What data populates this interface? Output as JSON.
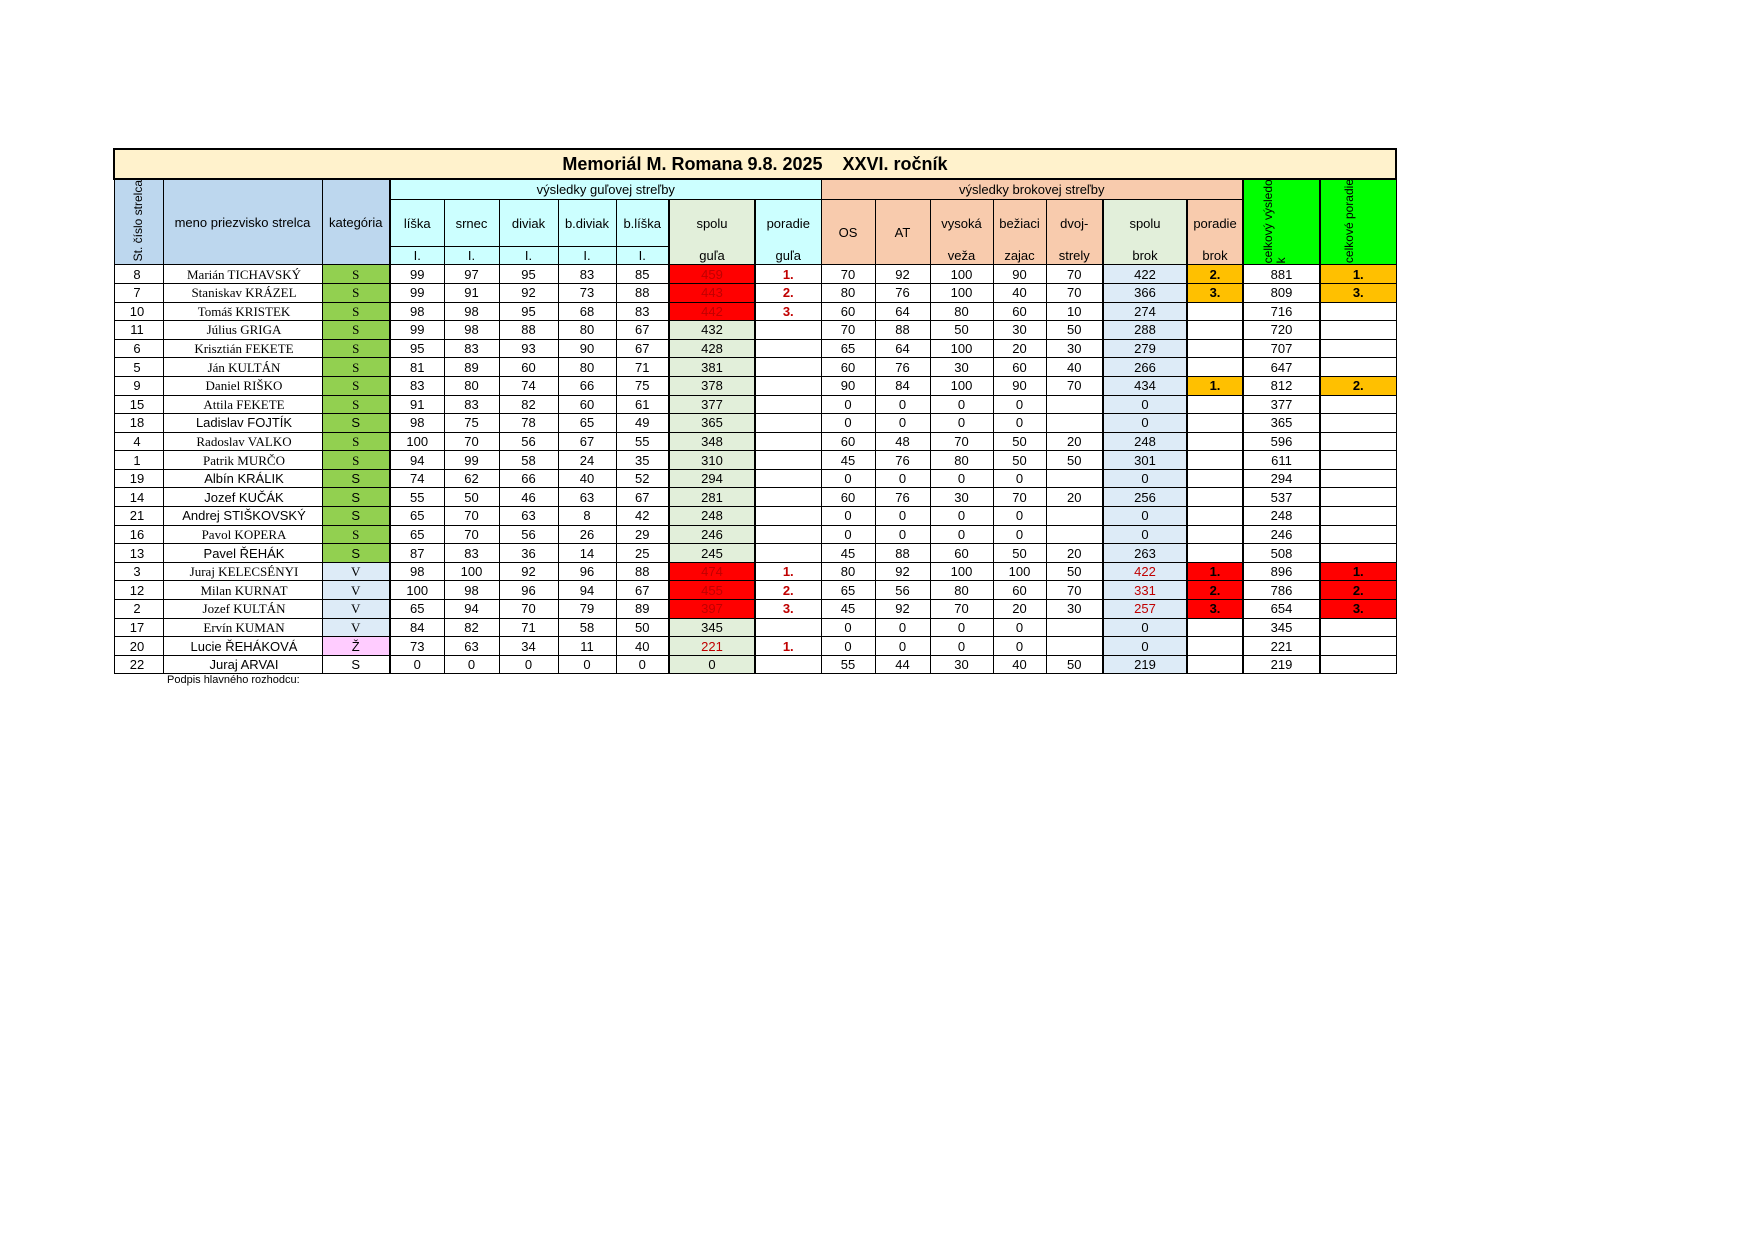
{
  "title": "Memoriál M. Romana 9.8. 2025    XXVI. ročník",
  "headers": {
    "st_cislo": "St. číslo strelca",
    "meno": "meno priezvisko strelca",
    "kategoria": "kategória",
    "gula_group": "výsledky guľovej streľby",
    "brok_group": "výsledky brokovej streľby",
    "liska": "líška",
    "srnec": "srnec",
    "diviak": "diviak",
    "bdiviak": "b.diviak",
    "bliska": "b.líška",
    "round": "I.",
    "spolu_gula_1": "spolu",
    "spolu_gula_2": "guľa",
    "poradie_gula_1": "poradie",
    "poradie_gula_2": "guľa",
    "os": "OS",
    "at": "AT",
    "vysoka_1": "vysoká",
    "vysoka_2": "veža",
    "beziaci_1": "bežiaci",
    "beziaci_2": "zajac",
    "dvoj_1": "dvoj-",
    "dvoj_2": "strely",
    "spolu_brok_1": "spolu",
    "spolu_brok_2": "brok",
    "poradie_brok_1": "poradie",
    "poradie_brok_2": "brok",
    "celkovy": "celkový výsledo k",
    "celkove": "celkové poradie"
  },
  "rows": [
    {
      "no": "8",
      "name": "Marián TICHAVSKÝ",
      "serif": true,
      "cat": "S",
      "g": [
        "99",
        "97",
        "95",
        "83",
        "85"
      ],
      "sg": "459",
      "sgc": "red",
      "pg": "1.",
      "b": [
        "70",
        "92",
        "100",
        "90",
        "70"
      ],
      "sb": "422",
      "sbc": "lblue",
      "pb": "2.",
      "pbc": "orange",
      "total": "881",
      "tr": "1.",
      "trc": "orange"
    },
    {
      "no": "7",
      "name": "Staniskav KRÁZEL",
      "serif": true,
      "cat": "S",
      "g": [
        "99",
        "91",
        "92",
        "73",
        "88"
      ],
      "sg": "443",
      "sgc": "red",
      "pg": "2.",
      "b": [
        "80",
        "76",
        "100",
        "40",
        "70"
      ],
      "sb": "366",
      "sbc": "lblue",
      "pb": "3.",
      "pbc": "orange",
      "total": "809",
      "tr": "3.",
      "trc": "orange"
    },
    {
      "no": "10",
      "name": "Tomáš KRISTEK",
      "serif": true,
      "cat": "S",
      "g": [
        "98",
        "98",
        "95",
        "68",
        "83"
      ],
      "sg": "442",
      "sgc": "red",
      "pg": "3.",
      "b": [
        "60",
        "64",
        "80",
        "60",
        "10"
      ],
      "sb": "274",
      "sbc": "lblue",
      "pb": "",
      "pbc": "",
      "total": "716",
      "tr": "",
      "trc": ""
    },
    {
      "no": "11",
      "name": "Július GRIGA",
      "serif": true,
      "cat": "S",
      "g": [
        "99",
        "98",
        "88",
        "80",
        "67"
      ],
      "sg": "432",
      "sgc": "lgreen",
      "pg": "",
      "b": [
        "70",
        "88",
        "50",
        "30",
        "50"
      ],
      "sb": "288",
      "sbc": "lblue",
      "pb": "",
      "pbc": "",
      "total": "720",
      "tr": "",
      "trc": ""
    },
    {
      "no": "6",
      "name": "Krisztián FEKETE",
      "serif": true,
      "cat": "S",
      "g": [
        "95",
        "83",
        "93",
        "90",
        "67"
      ],
      "sg": "428",
      "sgc": "lgreen",
      "pg": "",
      "b": [
        "65",
        "64",
        "100",
        "20",
        "30"
      ],
      "sb": "279",
      "sbc": "lblue",
      "pb": "",
      "pbc": "",
      "total": "707",
      "tr": "",
      "trc": ""
    },
    {
      "no": "5",
      "name": "Ján KULTÁN",
      "serif": true,
      "cat": "S",
      "g": [
        "81",
        "89",
        "60",
        "80",
        "71"
      ],
      "sg": "381",
      "sgc": "lgreen",
      "pg": "",
      "b": [
        "60",
        "76",
        "30",
        "60",
        "40"
      ],
      "sb": "266",
      "sbc": "lblue",
      "pb": "",
      "pbc": "",
      "total": "647",
      "tr": "",
      "trc": ""
    },
    {
      "no": "9",
      "name": "Daniel RIŠKO",
      "serif": true,
      "cat": "S",
      "g": [
        "83",
        "80",
        "74",
        "66",
        "75"
      ],
      "sg": "378",
      "sgc": "lgreen",
      "pg": "",
      "b": [
        "90",
        "84",
        "100",
        "90",
        "70"
      ],
      "sb": "434",
      "sbc": "lblue",
      "pb": "1.",
      "pbc": "orange",
      "total": "812",
      "tr": "2.",
      "trc": "orange"
    },
    {
      "no": "15",
      "name": "Attila FEKETE",
      "serif": true,
      "cat": "S",
      "g": [
        "91",
        "83",
        "82",
        "60",
        "61"
      ],
      "sg": "377",
      "sgc": "lgreen",
      "pg": "",
      "b": [
        "0",
        "0",
        "0",
        "0",
        ""
      ],
      "sb": "0",
      "sbc": "lblue",
      "pb": "",
      "pbc": "",
      "total": "377",
      "tr": "",
      "trc": ""
    },
    {
      "no": "18",
      "name": "Ladislav FOJTÍK",
      "serif": false,
      "cat": "S",
      "g": [
        "98",
        "75",
        "78",
        "65",
        "49"
      ],
      "sg": "365",
      "sgc": "lgreen",
      "pg": "",
      "b": [
        "0",
        "0",
        "0",
        "0",
        ""
      ],
      "sb": "0",
      "sbc": "lblue",
      "pb": "",
      "pbc": "",
      "total": "365",
      "tr": "",
      "trc": ""
    },
    {
      "no": "4",
      "name": "Radoslav VALKO",
      "serif": true,
      "cat": "S",
      "g": [
        "100",
        "70",
        "56",
        "67",
        "55"
      ],
      "sg": "348",
      "sgc": "lgreen",
      "pg": "",
      "b": [
        "60",
        "48",
        "70",
        "50",
        "20"
      ],
      "sb": "248",
      "sbc": "lblue",
      "pb": "",
      "pbc": "",
      "total": "596",
      "tr": "",
      "trc": ""
    },
    {
      "no": "1",
      "name": "Patrik MURČO",
      "serif": true,
      "cat": "S",
      "g": [
        "94",
        "99",
        "58",
        "24",
        "35"
      ],
      "sg": "310",
      "sgc": "lgreen",
      "pg": "",
      "b": [
        "45",
        "76",
        "80",
        "50",
        "50"
      ],
      "sb": "301",
      "sbc": "lblue",
      "pb": "",
      "pbc": "",
      "total": "611",
      "tr": "",
      "trc": ""
    },
    {
      "no": "19",
      "name": "Albín KRÁLIK",
      "serif": false,
      "cat": "S",
      "g": [
        "74",
        "62",
        "66",
        "40",
        "52"
      ],
      "sg": "294",
      "sgc": "lgreen",
      "pg": "",
      "b": [
        "0",
        "0",
        "0",
        "0",
        ""
      ],
      "sb": "0",
      "sbc": "lblue",
      "pb": "",
      "pbc": "",
      "total": "294",
      "tr": "",
      "trc": ""
    },
    {
      "no": "14",
      "name": "Jozef KUČÁK",
      "serif": false,
      "cat": "S",
      "g": [
        "55",
        "50",
        "46",
        "63",
        "67"
      ],
      "sg": "281",
      "sgc": "lgreen",
      "pg": "",
      "b": [
        "60",
        "76",
        "30",
        "70",
        "20"
      ],
      "sb": "256",
      "sbc": "lblue",
      "pb": "",
      "pbc": "",
      "total": "537",
      "tr": "",
      "trc": ""
    },
    {
      "no": "21",
      "name": "Andrej STIŠKOVSKÝ",
      "serif": false,
      "cat": "S",
      "g": [
        "65",
        "70",
        "63",
        "8",
        "42"
      ],
      "sg": "248",
      "sgc": "lgreen",
      "pg": "",
      "b": [
        "0",
        "0",
        "0",
        "0",
        ""
      ],
      "sb": "0",
      "sbc": "lblue",
      "pb": "",
      "pbc": "",
      "total": "248",
      "tr": "",
      "trc": ""
    },
    {
      "no": "16",
      "name": "Pavol KOPERA",
      "serif": true,
      "cat": "S",
      "g": [
        "65",
        "70",
        "56",
        "26",
        "29"
      ],
      "sg": "246",
      "sgc": "lgreen",
      "pg": "",
      "b": [
        "0",
        "0",
        "0",
        "0",
        ""
      ],
      "sb": "0",
      "sbc": "lblue",
      "pb": "",
      "pbc": "",
      "total": "246",
      "tr": "",
      "trc": ""
    },
    {
      "no": "13",
      "name": "Pavel ŘEHÁK",
      "serif": false,
      "cat": "S",
      "g": [
        "87",
        "83",
        "36",
        "14",
        "25"
      ],
      "sg": "245",
      "sgc": "lgreen",
      "pg": "",
      "b": [
        "45",
        "88",
        "60",
        "50",
        "20"
      ],
      "sb": "263",
      "sbc": "lblue",
      "pb": "",
      "pbc": "",
      "total": "508",
      "tr": "",
      "trc": ""
    },
    {
      "no": "3",
      "name": "Juraj KELECSÉNYI",
      "serif": true,
      "cat": "V",
      "g": [
        "98",
        "100",
        "92",
        "96",
        "88"
      ],
      "sg": "474",
      "sgc": "red",
      "pg": "1.",
      "b": [
        "80",
        "92",
        "100",
        "100",
        "50"
      ],
      "sb": "422",
      "sbc": "lblue",
      "sbt": "red",
      "pb": "1.",
      "pbc": "red",
      "total": "896",
      "tr": "1.",
      "trc": "red"
    },
    {
      "no": "12",
      "name": "Milan KURNAT",
      "serif": true,
      "cat": "V",
      "g": [
        "100",
        "98",
        "96",
        "94",
        "67"
      ],
      "sg": "455",
      "sgc": "red",
      "pg": "2.",
      "b": [
        "65",
        "56",
        "80",
        "60",
        "70"
      ],
      "sb": "331",
      "sbc": "lblue",
      "sbt": "red",
      "pb": "2.",
      "pbc": "red",
      "total": "786",
      "tr": "2.",
      "trc": "red"
    },
    {
      "no": "2",
      "name": "Jozef KULTÁN",
      "serif": true,
      "cat": "V",
      "g": [
        "65",
        "94",
        "70",
        "79",
        "89"
      ],
      "sg": "397",
      "sgc": "red",
      "pg": "3.",
      "b": [
        "45",
        "92",
        "70",
        "20",
        "30"
      ],
      "sb": "257",
      "sbc": "lblue",
      "sbt": "red",
      "pb": "3.",
      "pbc": "red",
      "total": "654",
      "tr": "3.",
      "trc": "red"
    },
    {
      "no": "17",
      "name": "Ervín KUMAN",
      "serif": true,
      "cat": "V",
      "g": [
        "84",
        "82",
        "71",
        "58",
        "50"
      ],
      "sg": "345",
      "sgc": "lgreen",
      "pg": "",
      "b": [
        "0",
        "0",
        "0",
        "0",
        ""
      ],
      "sb": "0",
      "sbc": "lblue",
      "pb": "",
      "pbc": "",
      "total": "345",
      "tr": "",
      "trc": ""
    },
    {
      "no": "20",
      "name": "Lucie ŘEHÁKOVÁ",
      "serif": false,
      "cat": "Ž",
      "g": [
        "73",
        "63",
        "34",
        "11",
        "40"
      ],
      "sg": "221",
      "sgc": "lgreen",
      "sgt": "red",
      "pg": "1.",
      "b": [
        "0",
        "0",
        "0",
        "0",
        ""
      ],
      "sb": "0",
      "sbc": "lblue",
      "pb": "",
      "pbc": "",
      "total": "221",
      "tr": "",
      "trc": ""
    },
    {
      "no": "22",
      "name": "Juraj ARVAI",
      "serif": false,
      "cat": "S",
      "catplain": true,
      "g": [
        "0",
        "0",
        "0",
        "0",
        "0"
      ],
      "sg": "0",
      "sgc": "lgreen",
      "pg": "",
      "b": [
        "55",
        "44",
        "30",
        "40",
        "50"
      ],
      "sb": "219",
      "sbc": "lblue",
      "pb": "",
      "pbc": "",
      "total": "219",
      "tr": "",
      "trc": ""
    }
  ],
  "signature": "Podpis hlavného rozhodcu:"
}
